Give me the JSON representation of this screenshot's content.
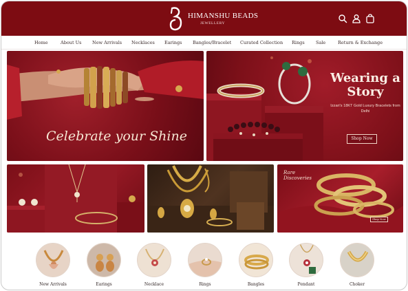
{
  "brand": {
    "name": "HIMANSHU BEADS",
    "tagline": "JEWELLERY",
    "primary_color": "#7d0c12"
  },
  "header_icons": [
    "search-icon",
    "user-icon",
    "cart-icon"
  ],
  "nav": {
    "items": [
      {
        "label": "Home"
      },
      {
        "label": "About Us"
      },
      {
        "label": "New Arrivals"
      },
      {
        "label": "Necklaces"
      },
      {
        "label": "Earings"
      },
      {
        "label": "Bangles/Bracelet"
      },
      {
        "label": "Curated Collection"
      },
      {
        "label": "Rings"
      },
      {
        "label": "Sale"
      },
      {
        "label": "Return & Exchange"
      }
    ]
  },
  "banners": {
    "celebrate": {
      "headline": "Celebrate your Shine"
    },
    "wearing": {
      "headline": "Wearing a Story",
      "subtext": "Izzari's 18KT Gold Luxury Bracelets from Delhi",
      "cta": "Shop Now"
    },
    "rare": {
      "headline": "Rare Discoveries",
      "cta": "Shop Now"
    }
  },
  "categories": [
    {
      "label": "New Arrivals"
    },
    {
      "label": "Earings"
    },
    {
      "label": "Necklace"
    },
    {
      "label": "Rings"
    },
    {
      "label": "Bangles"
    },
    {
      "label": "Pendant"
    },
    {
      "label": "Choker"
    }
  ]
}
